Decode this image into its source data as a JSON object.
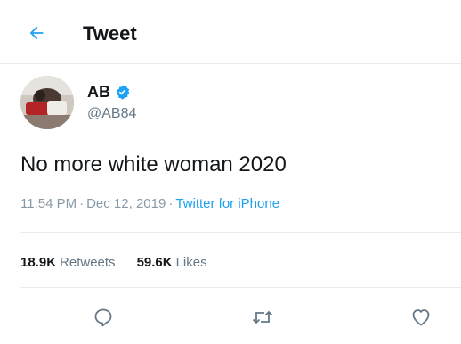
{
  "header": {
    "title": "Tweet",
    "back_icon": "arrow-left-icon"
  },
  "author": {
    "name": "AB",
    "handle": "@AB84",
    "verified": true
  },
  "tweet": {
    "text": "No more white woman 2020",
    "time": "11:54 PM",
    "date": "Dec 12, 2019",
    "separator": "·",
    "source": "Twitter for iPhone"
  },
  "stats": {
    "retweets_count": "18.9K",
    "retweets_label": "Retweets",
    "likes_count": "59.6K",
    "likes_label": "Likes"
  },
  "actions": {
    "reply_icon": "reply-icon",
    "retweet_icon": "retweet-icon",
    "like_icon": "heart-icon"
  },
  "colors": {
    "accent": "#1da1f2",
    "text": "#14171a",
    "muted": "#657786",
    "divider": "#e6ecf0"
  }
}
